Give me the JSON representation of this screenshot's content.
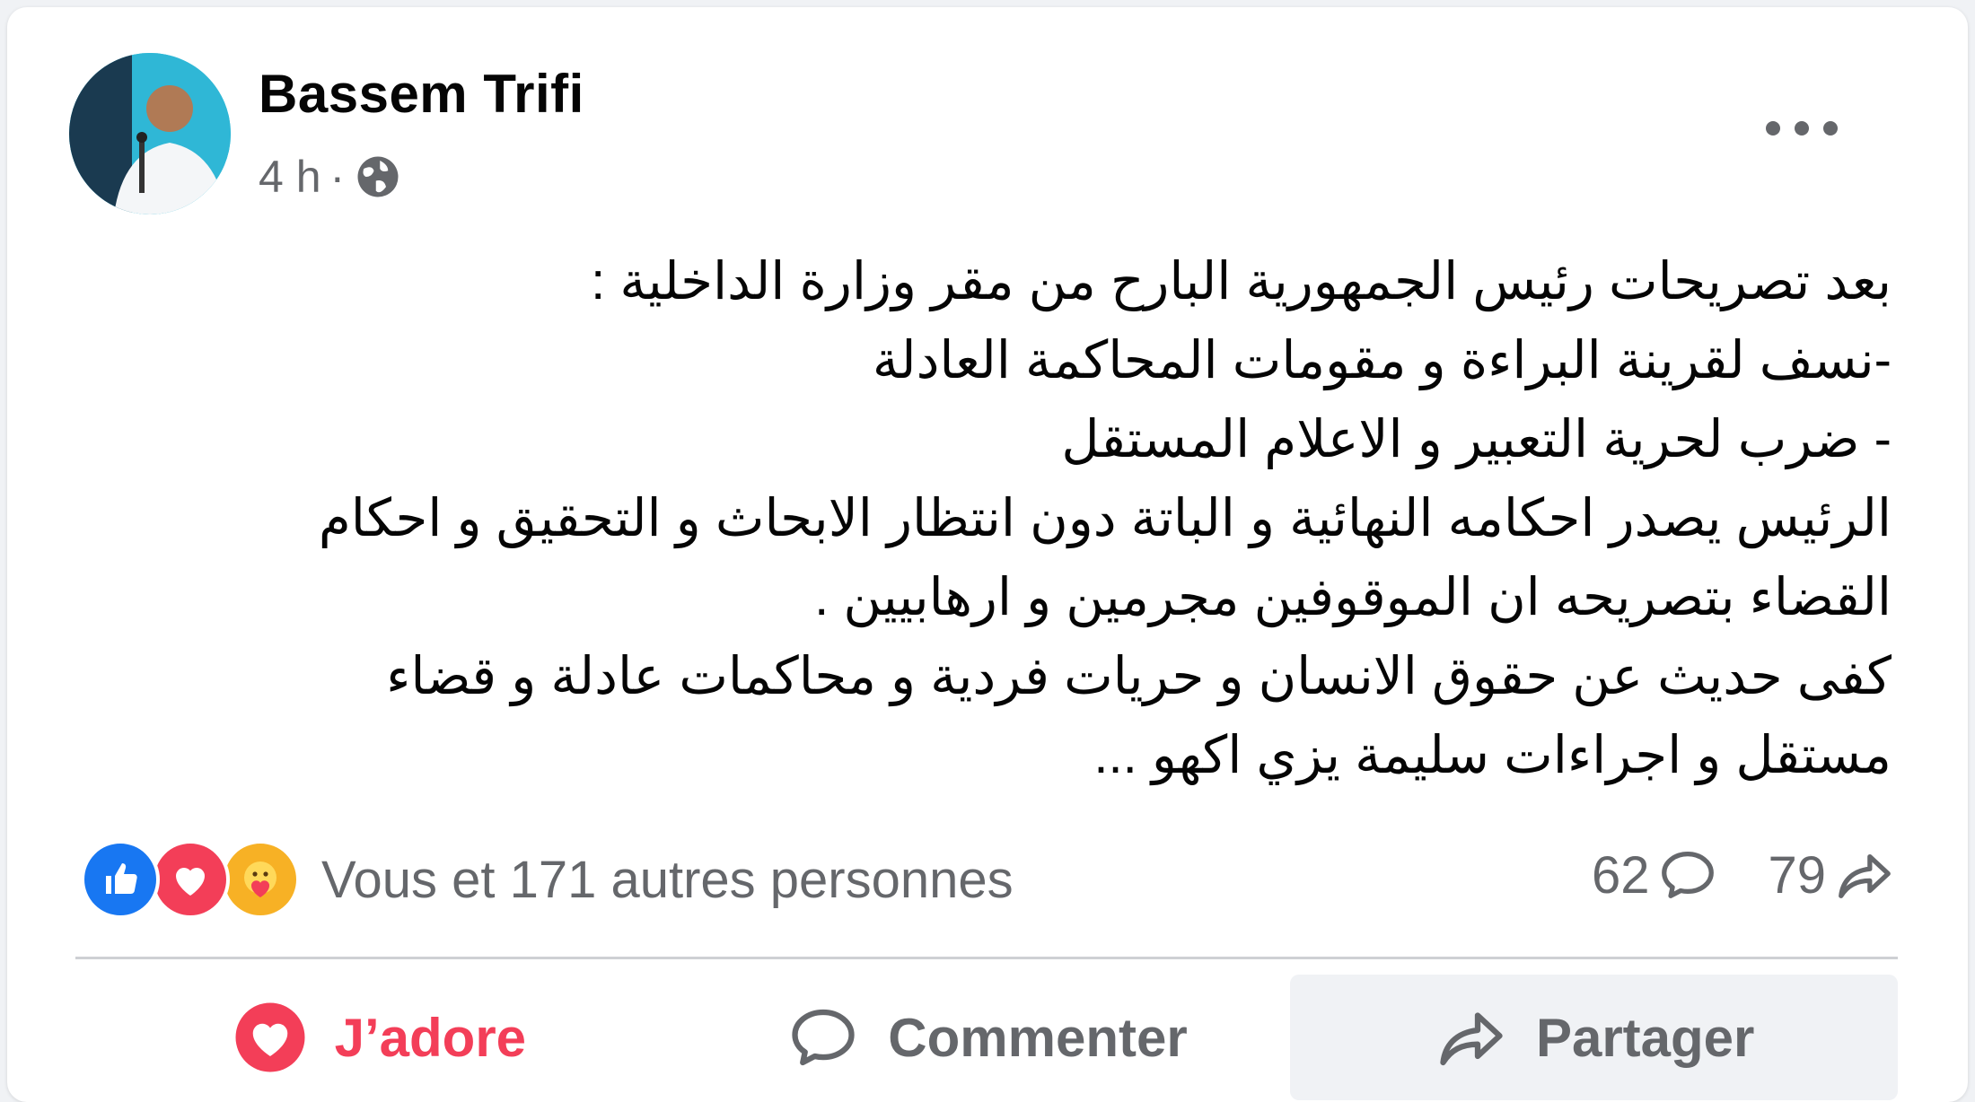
{
  "post": {
    "author": "Bassem Trifi",
    "time": "4 h",
    "separator": "·",
    "privacy_icon": "globe-icon",
    "body_lines": [
      "بعد تصريحات رئيس الجمهورية البارح من مقر وزارة الداخلية :",
      "-نسف لقرينة البراءة و مقومات المحاكمة العادلة",
      "- ضرب لحرية التعبير و الاعلام المستقل",
      "الرئيس يصدر احكامه النهائية و الباتة دون انتظار الابحاث و التحقيق و احكام",
      "القضاء بتصريحه ان الموقوفين مجرمين و ارهابيين .",
      "كفى حديث عن حقوق الانسان و حريات فردية و محاكمات عادلة و قضاء",
      "مستقل و اجراءات سليمة يزي اكهو ..."
    ]
  },
  "reactions": {
    "icons": [
      "like-icon",
      "love-icon",
      "care-icon"
    ],
    "summary": "Vous et 171 autres personnes",
    "comments_count": "62",
    "shares_count": "79"
  },
  "actions": {
    "love_label": "J’adore",
    "comment_label": "Commenter",
    "share_label": "Partager"
  },
  "colors": {
    "like": "#1877f2",
    "love": "#f33e58",
    "care": "#f7b125",
    "secondary_text": "#65676b"
  }
}
